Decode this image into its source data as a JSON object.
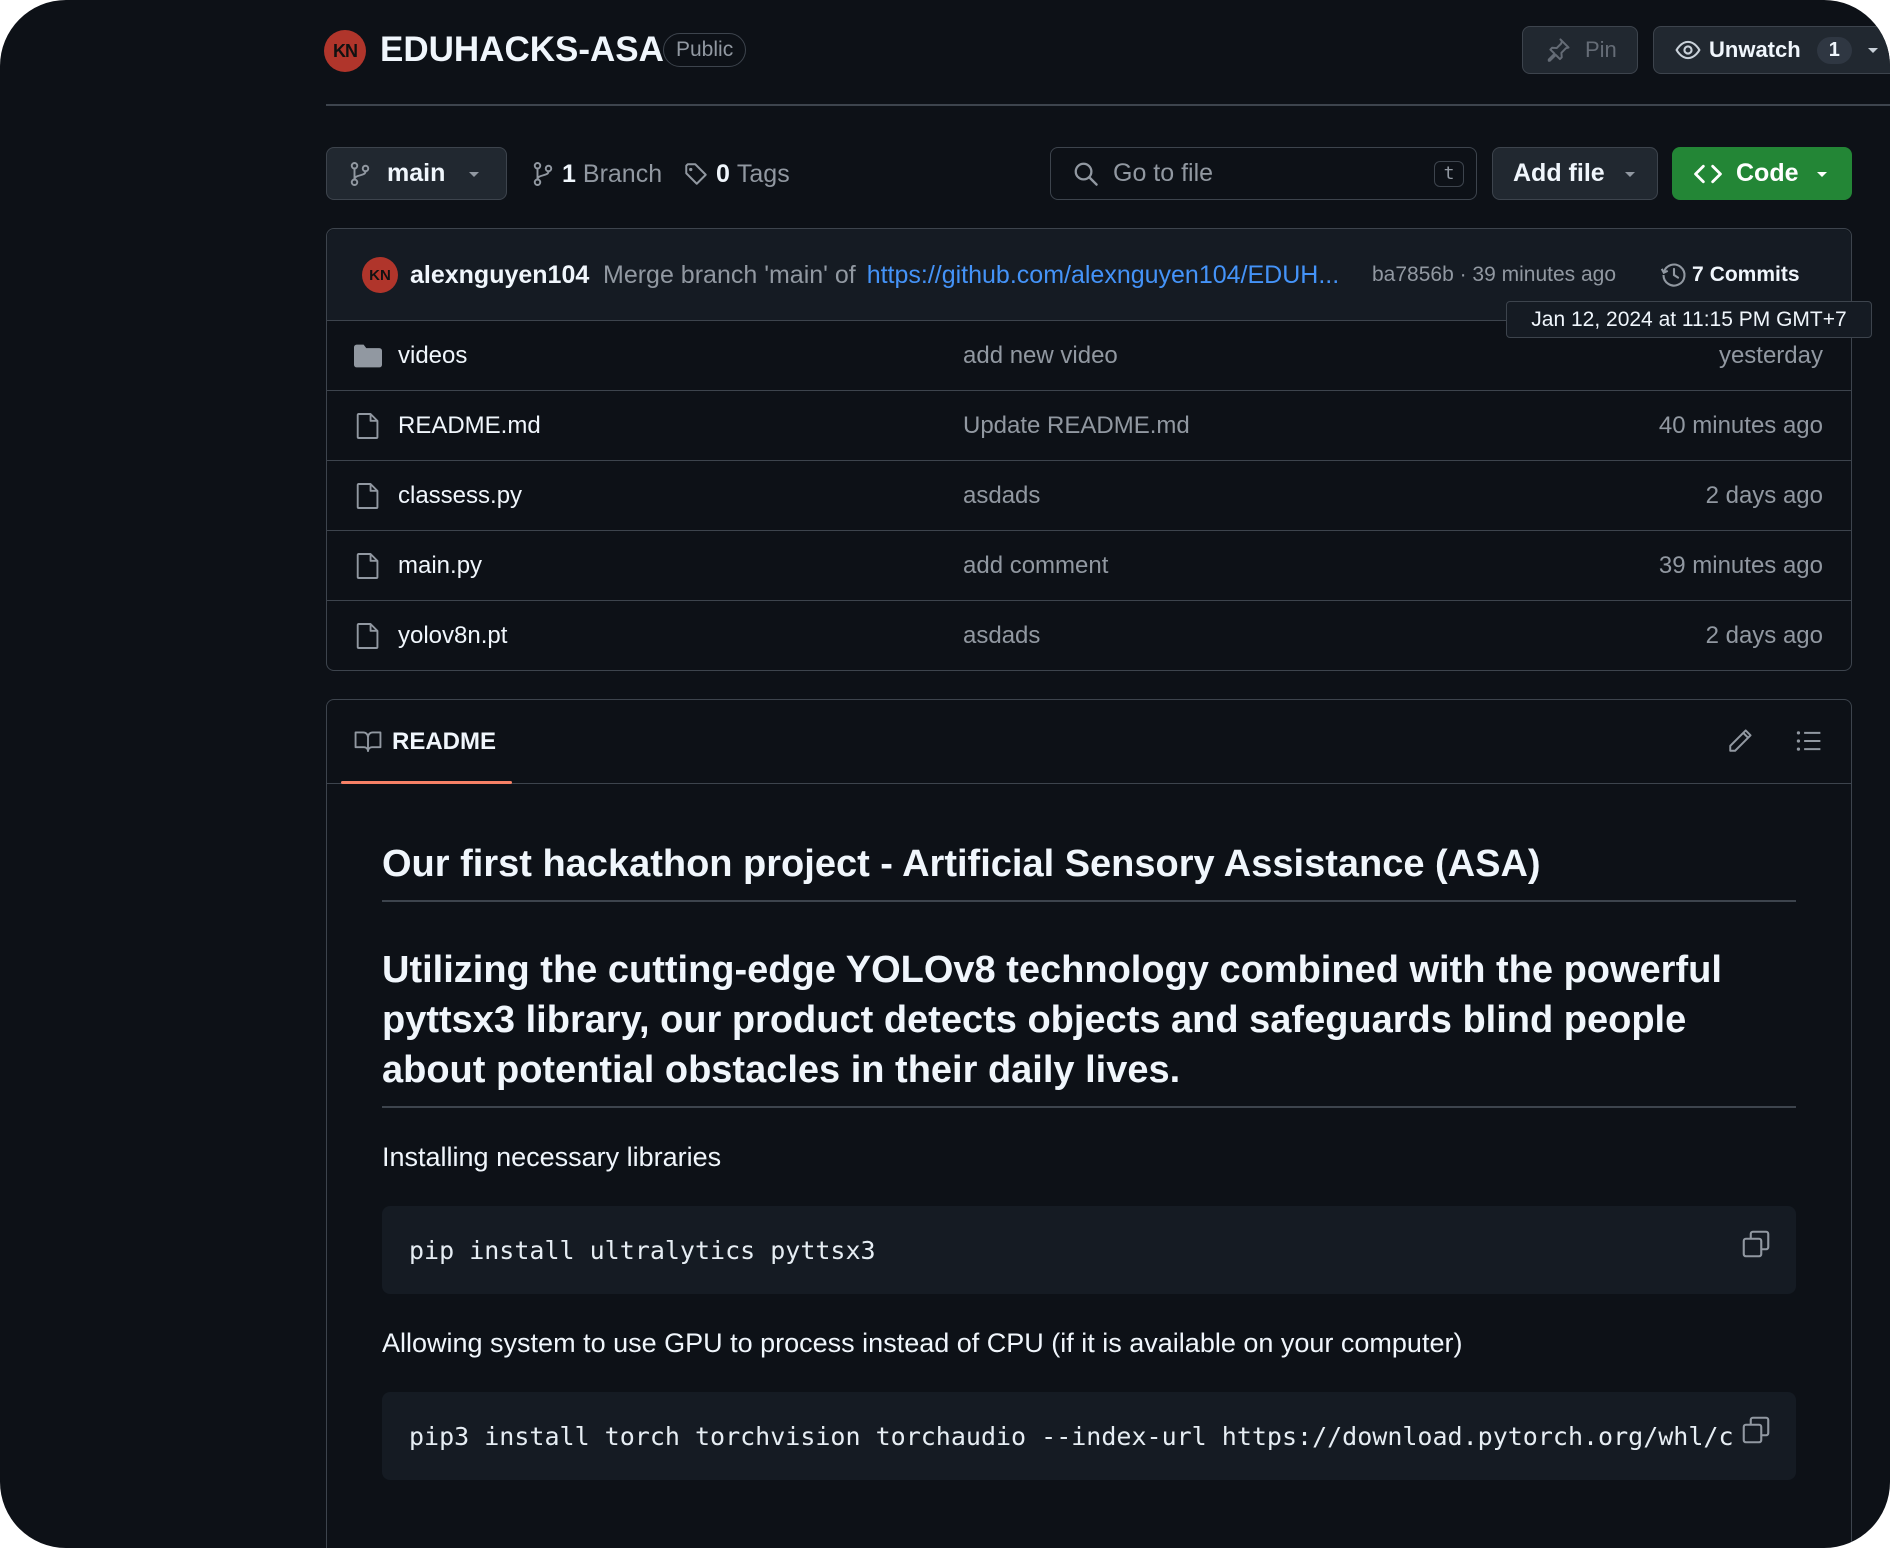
{
  "repo": {
    "name": "EDUHACKS-ASA",
    "visibility": "Public"
  },
  "header_actions": {
    "pin_label": "Pin",
    "unwatch_label": "Unwatch",
    "watch_count": "1"
  },
  "toolbar": {
    "branch": "main",
    "branch_count": "1",
    "branch_label": "Branch",
    "tag_count": "0",
    "tag_label": "Tags",
    "search_placeholder": "Go to file",
    "search_shortcut": "t",
    "add_file_label": "Add file",
    "code_label": "Code"
  },
  "latest_commit": {
    "author": "alexnguyen104",
    "message_prefix": "Merge branch 'main' of",
    "message_link": "https://github.com/alexnguyen104/EDUH...",
    "hash_time": "ba7856b · 39 minutes ago",
    "commits_count": "7",
    "commits_label": "Commits",
    "tooltip": "Jan 12, 2024 at 11:15 PM GMT+7"
  },
  "files": [
    {
      "type": "folder",
      "name": "videos",
      "message": "add new video",
      "time": "yesterday"
    },
    {
      "type": "file",
      "name": "README.md",
      "message": "Update README.md",
      "time": "40 minutes ago"
    },
    {
      "type": "file",
      "name": "classess.py",
      "message": "asdads",
      "time": "2 days ago"
    },
    {
      "type": "file",
      "name": "main.py",
      "message": "add comment",
      "time": "39 minutes ago"
    },
    {
      "type": "file",
      "name": "yolov8n.pt",
      "message": "asdads",
      "time": "2 days ago"
    }
  ],
  "readme": {
    "tab_label": "README",
    "h1": "Our first hackathon project - Artificial Sensory Assistance (ASA)",
    "h2": "Utilizing the cutting-edge YOLOv8 technology combined with the powerful pyttsx3 library, our product detects objects and safeguards blind people about potential obstacles in their daily lives.",
    "p1": "Installing necessary libraries",
    "code1": "pip install ultralytics pyttsx3",
    "p2": "Allowing system to use GPU to process instead of CPU (if it is available on your computer)",
    "code2": "pip3 install torch torchvision torchaudio --index-url https://download.pytorch.org/whl/c"
  },
  "colors": {
    "background": "#0d1117",
    "accent_green": "#238636",
    "link_blue": "#4493f8",
    "tab_underline": "#f78166"
  }
}
